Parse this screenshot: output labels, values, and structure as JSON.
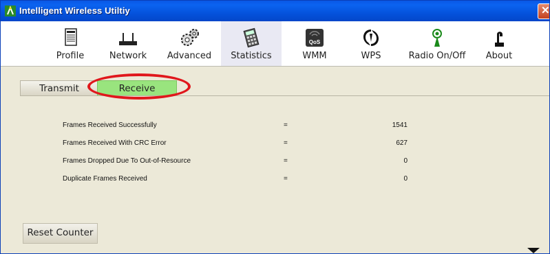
{
  "window": {
    "title": "Intelligent Wireless Utiltiy",
    "close_glyph": "✕"
  },
  "toolbar": {
    "items": [
      {
        "label": "Profile",
        "icon": "profile-icon"
      },
      {
        "label": "Network",
        "icon": "router-icon"
      },
      {
        "label": "Advanced",
        "icon": "gears-icon"
      },
      {
        "label": "Statistics",
        "icon": "calculator-icon",
        "active": true
      },
      {
        "label": "WMM",
        "icon": "qos-icon"
      },
      {
        "label": "WPS",
        "icon": "wps-icon"
      },
      {
        "label": "Radio On/Off",
        "icon": "radio-antenna-icon"
      },
      {
        "label": "About",
        "icon": "about-icon"
      }
    ],
    "qos_badge": "QoS"
  },
  "tabs": {
    "transmit": "Transmit",
    "receive": "Receive",
    "active": "Receive"
  },
  "stats": [
    {
      "label": "Frames Received Successfully",
      "eq": "=",
      "value": "1541"
    },
    {
      "label": "Frames Received With CRC Error",
      "eq": "=",
      "value": "627"
    },
    {
      "label": "Frames Dropped Due To Out-of-Resource",
      "eq": "=",
      "value": "0"
    },
    {
      "label": "Duplicate Frames Received",
      "eq": "=",
      "value": "0"
    }
  ],
  "reset_button": "Reset Counter",
  "colors": {
    "titlebar": "#0553dd",
    "active_tab": "#99e47e",
    "highlight": "#e0171c",
    "background": "#ece9d8"
  }
}
